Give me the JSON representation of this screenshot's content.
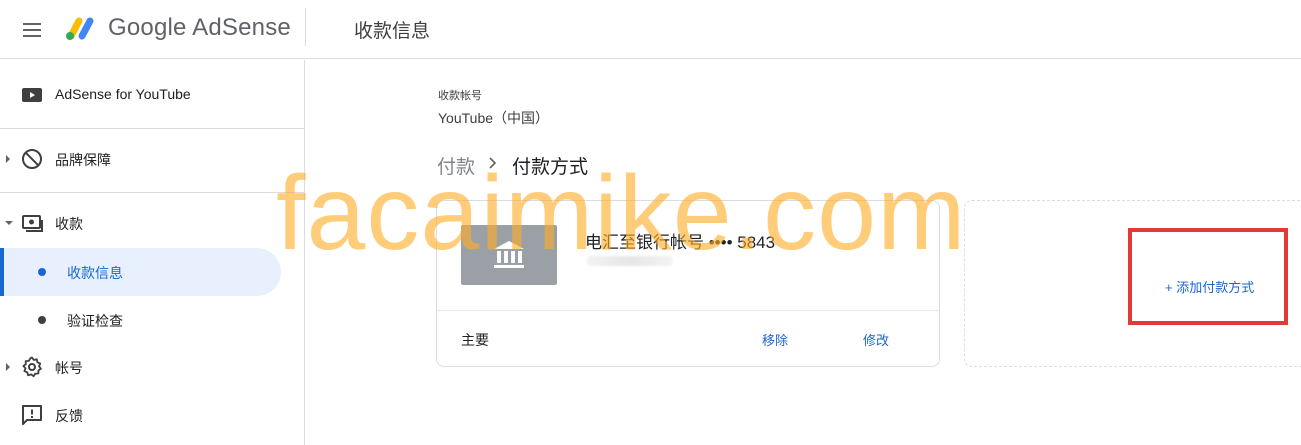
{
  "header": {
    "brand": "Google AdSense",
    "page_title": "收款信息"
  },
  "sidebar": {
    "items": [
      {
        "label": "AdSense for YouTube",
        "icon": "youtube-icon"
      },
      {
        "label": "品牌保障",
        "icon": "block-icon"
      },
      {
        "label": "收款",
        "icon": "payments-icon"
      },
      {
        "label": "帐号",
        "icon": "gear-icon"
      },
      {
        "label": "反馈",
        "icon": "feedback-icon"
      }
    ],
    "payments_sub": [
      {
        "label": "收款信息",
        "active": true
      },
      {
        "label": "验证检查",
        "active": false
      }
    ]
  },
  "main": {
    "account_label": "收款帐号",
    "account_value": "YouTube（中国）",
    "breadcrumb": {
      "root": "付款",
      "current": "付款方式"
    },
    "payment_method": {
      "name": "电汇至银行帐号 •••• 5843",
      "status": "主要",
      "remove_label": "移除",
      "edit_label": "修改"
    },
    "add_method_label": "+ 添加付款方式"
  },
  "overlay": {
    "watermark": "facaimike.com",
    "highlight_color": "#e53935",
    "watermark_color": "#ffac28"
  },
  "colors": {
    "accent": "#1967d2",
    "active_bg": "#e8f0fe"
  }
}
